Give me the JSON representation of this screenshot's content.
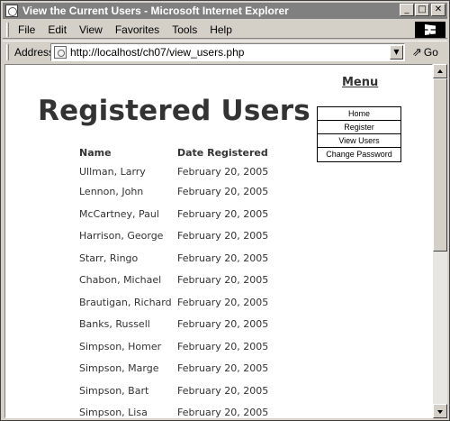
{
  "window": {
    "title": "View the Current Users - Microsoft Internet Explorer",
    "buttons": {
      "minimize": "_",
      "maximize": "□",
      "close": "✕"
    }
  },
  "menubar": {
    "items": [
      "File",
      "Edit",
      "View",
      "Favorites",
      "Tools",
      "Help"
    ]
  },
  "address": {
    "label": "Address",
    "url": "http://localhost/ch07/view_users.php",
    "go_label": "Go",
    "go_arrow": "⇗"
  },
  "page": {
    "title": "Registered Users",
    "columns": [
      "Name",
      "Date Registered"
    ],
    "users": [
      {
        "name": "Ullman, Larry",
        "date": "February 20, 2005"
      },
      {
        "name": "Lennon, John",
        "date": "February 20, 2005"
      },
      {
        "name": "McCartney, Paul",
        "date": "February 20, 2005"
      },
      {
        "name": "Harrison, George",
        "date": "February 20, 2005"
      },
      {
        "name": "Starr, Ringo",
        "date": "February 20, 2005"
      },
      {
        "name": "Chabon, Michael",
        "date": "February 20, 2005"
      },
      {
        "name": "Brautigan, Richard",
        "date": "February 20, 2005"
      },
      {
        "name": "Banks, Russell",
        "date": "February 20, 2005"
      },
      {
        "name": "Simpson, Homer",
        "date": "February 20, 2005"
      },
      {
        "name": "Simpson, Marge",
        "date": "February 20, 2005"
      },
      {
        "name": "Simpson, Bart",
        "date": "February 20, 2005"
      },
      {
        "name": "Simpson, Lisa",
        "date": "February 20, 2005"
      }
    ]
  },
  "sidemenu": {
    "heading": "Menu",
    "items": [
      "Home",
      "Register",
      "View Users",
      "Change Password"
    ]
  },
  "icons": {
    "window_icon": "ie-page-icon",
    "windows_logo": "windows-logo-icon",
    "page_icon": "page-icon",
    "dropdown": "chevron-down-icon"
  }
}
